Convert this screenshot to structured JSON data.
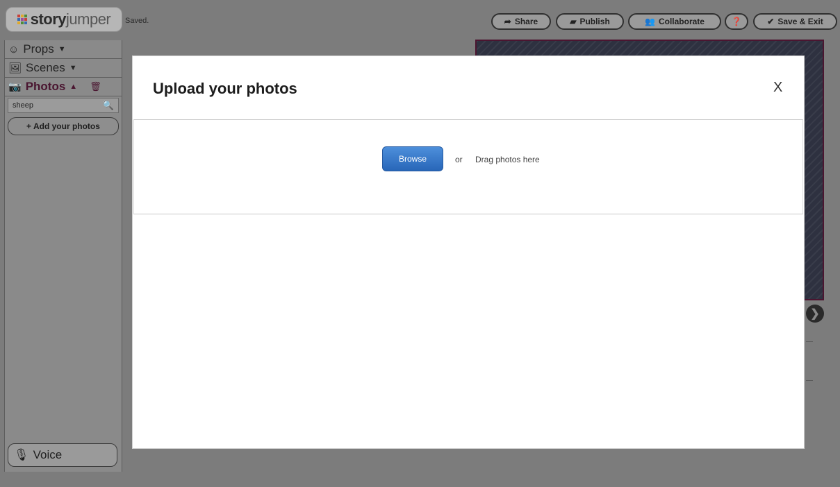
{
  "app": {
    "logo_bold": "story",
    "logo_light": "jumper",
    "status": "Saved."
  },
  "toolbar": {
    "share": "Share",
    "publish": "Publish",
    "collaborate": "Collaborate",
    "save_exit": "Save & Exit"
  },
  "sidebar": {
    "props": "Props",
    "scenes": "Scenes",
    "photos": "Photos",
    "search_value": "sheep",
    "add_photos": "+ Add your photos",
    "voice": "Voice"
  },
  "modal": {
    "title": "Upload your photos",
    "close": "X",
    "browse": "Browse",
    "or": "or",
    "drag_text": "Drag photos here"
  },
  "icons": [
    "share-icon",
    "publish-icon",
    "collaborate-icon",
    "help-icon",
    "save-exit-icon",
    "smiley-icon",
    "scene-icon",
    "camera-icon",
    "trash-icon",
    "search-icon",
    "microphone-icon",
    "next-arrow-icon"
  ],
  "colors": {
    "browse_button": "#2f6fc0",
    "photos_accent": "#4a1530",
    "overlay": "#7c7c7c",
    "modal_bg": "#ffffff"
  }
}
